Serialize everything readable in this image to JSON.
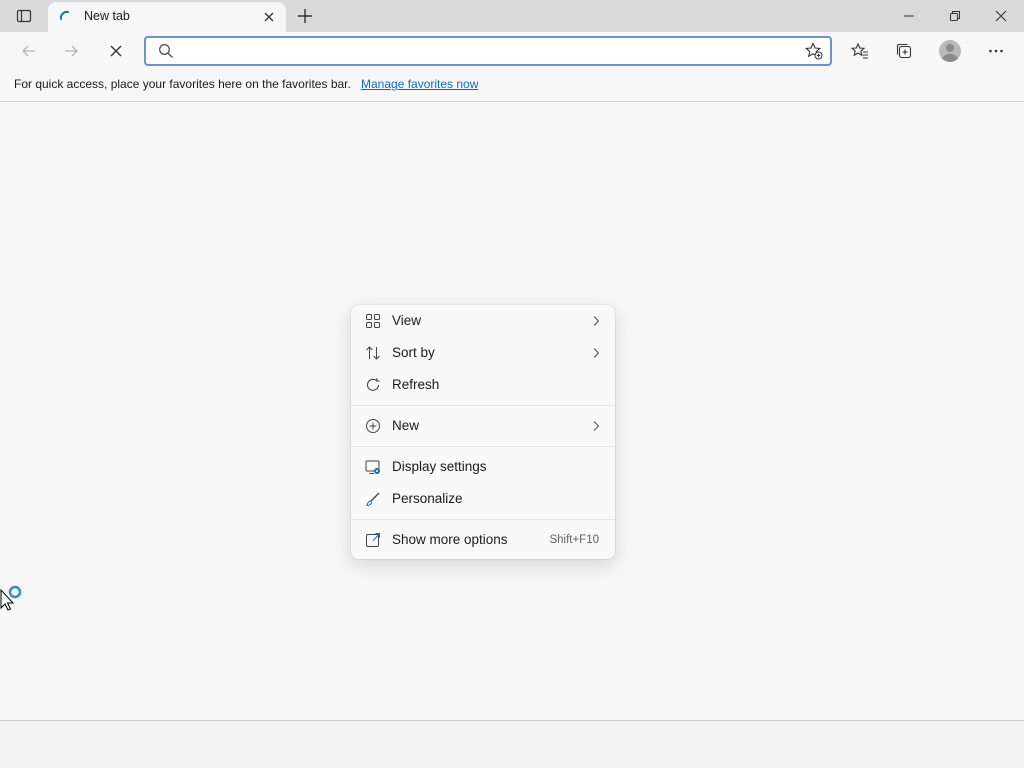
{
  "browser": {
    "tab": {
      "title": "New tab"
    },
    "address": {
      "value": "",
      "placeholder": ""
    },
    "favorites_bar": {
      "message": "For quick access, place your favorites here on the favorites bar.",
      "link": "Manage favorites now"
    }
  },
  "context_menu": {
    "items": [
      {
        "label": "View",
        "icon": "grid-view-icon",
        "submenu": true
      },
      {
        "label": "Sort by",
        "icon": "sort-icon",
        "submenu": true
      },
      {
        "label": "Refresh",
        "icon": "refresh-icon",
        "submenu": false
      },
      {
        "label": "New",
        "icon": "add-circle-icon",
        "submenu": true
      },
      {
        "label": "Display settings",
        "icon": "display-settings-icon",
        "submenu": false
      },
      {
        "label": "Personalize",
        "icon": "brush-icon",
        "submenu": false
      },
      {
        "label": "Show more options",
        "icon": "open-external-icon",
        "shortcut": "Shift+F10"
      }
    ]
  },
  "colors": {
    "accent": "#0f6cbd",
    "address_focus_border": "#6f8fd6",
    "titlebar_bg": "#d9d9d9",
    "page_bg": "#f7f7f7"
  }
}
